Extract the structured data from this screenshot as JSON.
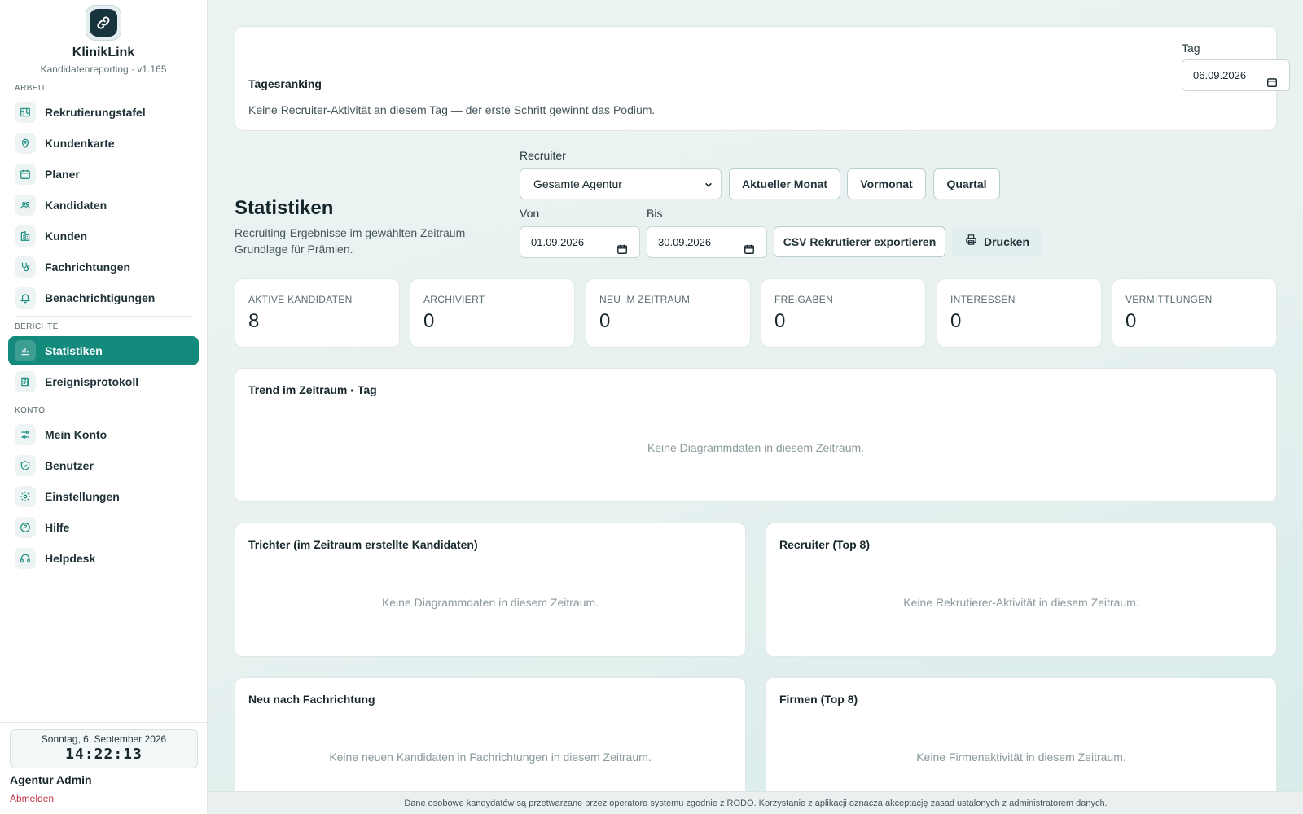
{
  "brand": {
    "name": "KlinikLink",
    "subtitle": "Kandidatenreporting · v1.165"
  },
  "sidebar": {
    "section_work": "ARBEIT",
    "work_items": [
      {
        "label": "Rekrutierungstafel",
        "icon": "board-icon"
      },
      {
        "label": "Kundenkarte",
        "icon": "map-pin-icon"
      },
      {
        "label": "Planer",
        "icon": "calendar-icon"
      },
      {
        "label": "Kandidaten",
        "icon": "users-icon"
      },
      {
        "label": "Kunden",
        "icon": "building-icon"
      },
      {
        "label": "Fachrichtungen",
        "icon": "stethoscope-icon"
      },
      {
        "label": "Benachrichtigungen",
        "icon": "bell-icon"
      }
    ],
    "section_reports": "BERICHTE",
    "report_items": [
      {
        "label": "Statistiken",
        "icon": "bar-chart-icon",
        "active": true
      },
      {
        "label": "Ereignisprotokoll",
        "icon": "log-icon"
      }
    ],
    "section_account": "KONTO",
    "account_items": [
      {
        "label": "Mein Konto",
        "icon": "sliders-icon"
      },
      {
        "label": "Benutzer",
        "icon": "shield-icon"
      },
      {
        "label": "Einstellungen",
        "icon": "gear-icon"
      },
      {
        "label": "Hilfe",
        "icon": "help-icon"
      },
      {
        "label": "Helpdesk",
        "icon": "headset-icon"
      }
    ],
    "clock_date": "Sonntag, 6. September 2026",
    "clock_time": "14:22:13",
    "user_name": "Agentur Admin",
    "logout_label": "Abmelden"
  },
  "ranking": {
    "title": "Tagesranking",
    "message": "Keine Recruiter-Aktivität an diesem Tag — der erste Schritt gewinnt das Podium.",
    "day_label": "Tag",
    "day_value": "06.09.2026"
  },
  "stats": {
    "title": "Statistiken",
    "subtitle": "Recruiting-Ergebnisse im gewählten Zeitraum — Grundlage für Prämien.",
    "recruiter_label": "Recruiter",
    "recruiter_value": "Gesamte Agentur",
    "btn_current_month": "Aktueller Monat",
    "btn_prev_month": "Vormonat",
    "btn_quarter": "Quartal",
    "from_label": "Von",
    "from_value": "01.09.2026",
    "to_label": "Bis",
    "to_value": "30.09.2026",
    "btn_csv": "CSV Rekrutierer exportieren",
    "btn_print": "Drucken"
  },
  "kpis": [
    {
      "label": "AKTIVE KANDIDATEN",
      "value": "8"
    },
    {
      "label": "ARCHIVIERT",
      "value": "0"
    },
    {
      "label": "NEU IM ZEITRAUM",
      "value": "0"
    },
    {
      "label": "FREIGABEN",
      "value": "0"
    },
    {
      "label": "INTERESSEN",
      "value": "0"
    },
    {
      "label": "VERMITTLUNGEN",
      "value": "0"
    }
  ],
  "panels": {
    "trend_title": "Trend im Zeitraum · Tag",
    "trend_empty": "Keine Diagrammdaten in diesem Zeitraum.",
    "funnel_title": "Trichter (im Zeitraum erstellte Kandidaten)",
    "funnel_empty": "Keine Diagrammdaten in diesem Zeitraum.",
    "recruiter_title": "Recruiter (Top 8)",
    "recruiter_empty": "Keine Rekrutierer-Aktivität in diesem Zeitraum.",
    "specialty_title": "Neu nach Fachrichtung",
    "specialty_empty": "Keine neuen Kandidaten in Fachrichtungen in diesem Zeitraum.",
    "companies_title": "Firmen (Top 8)",
    "companies_empty": "Keine Firmenaktivität in diesem Zeitraum."
  },
  "disclaimer": "Dane osobowe kandydatów są przetwarzane przez operatora systemu zgodnie z RODO. Korzystanie z aplikacji oznacza akceptację zasad ustalonych z administratorem danych.",
  "colors": {
    "accent": "#138a7c",
    "logout": "#c0334a"
  }
}
